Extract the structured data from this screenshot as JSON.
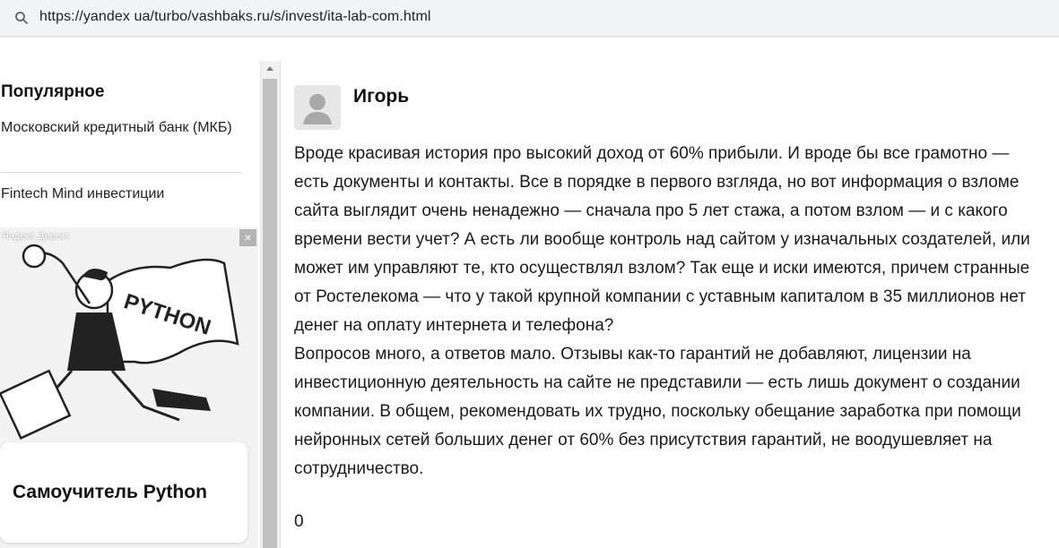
{
  "browser": {
    "url": "https://yandex ua/turbo/vashbaks.ru/s/invest/ita-lab-com.html",
    "search_icon": "search-icon"
  },
  "sidebar": {
    "title": "Популярное",
    "items": [
      {
        "label": "Московский кредитный банк (МКБ)"
      },
      {
        "label": "Fintech Mind инвестиции"
      }
    ]
  },
  "ad": {
    "label": "Яндекс Директ",
    "close": "×",
    "illustration_text": "PYTHON",
    "card_title": "Самоучитель Python"
  },
  "comment": {
    "author": "Игорь",
    "avatar_icon": "user-icon",
    "paragraphs": [
      "Вроде красивая история про высокий доход от 60% прибыли. И вроде бы все грамотно — есть документы и контакты. Все в порядке в первого взгляда, но вот информация о взломе сайта выглядит очень ненадежно — сначала про 5 лет стажа, а потом взлом — и с какого времени вести учет? А есть ли вообще контроль над сайтом у изначальных создателей, или может им управляют те, кто осуществлял взлом? Так еще и иски имеются, причем странные от Ростелекома — что у такой крупной компании с уставным капиталом в 35 миллионов нет денег на оплату интернета и телефона?",
      "Вопросов много, а ответов мало. Отзывы как-то гарантий не добавляют, лицензии на инвестиционную деятельность на сайте не представили — есть лишь документ о создании компании. В общем, рекомендовать их трудно, поскольку обещание заработка при помощи нейронных сетей больших денег от 60% без присутствия гарантий, не воодушевляет на сотрудничество."
    ],
    "count": "0"
  }
}
